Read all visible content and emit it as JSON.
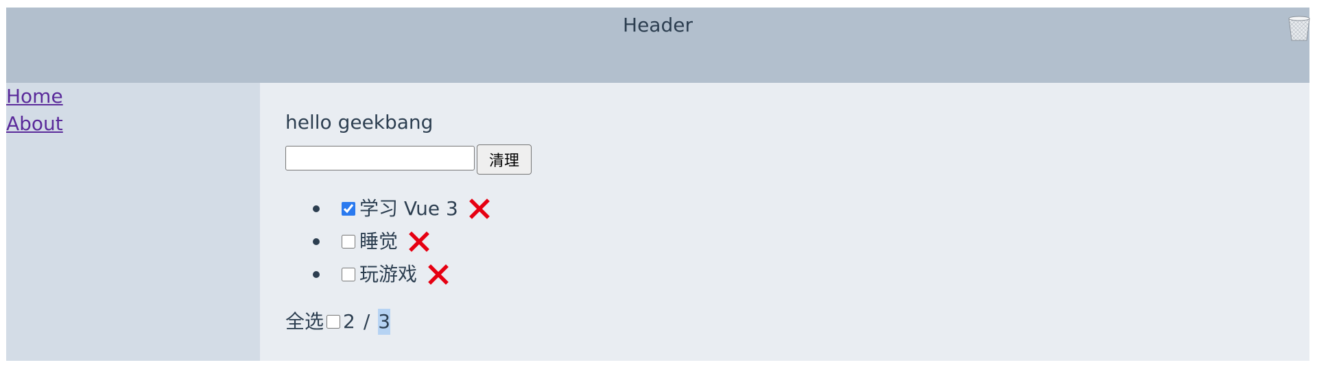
{
  "header": {
    "title": "Header"
  },
  "sidebar": {
    "links": [
      {
        "label": "Home"
      },
      {
        "label": "About"
      }
    ]
  },
  "main": {
    "greeting": "hello geekbang",
    "input": {
      "value": "",
      "placeholder": ""
    },
    "clear_label": "清理",
    "todos": [
      {
        "text": "学习 Vue 3",
        "done": true
      },
      {
        "text": "睡觉",
        "done": false
      },
      {
        "text": "玩游戏",
        "done": false
      }
    ],
    "footer": {
      "select_all_label": "全选",
      "select_all_checked": false,
      "active_count": "2",
      "separator": "/",
      "total_count": "3"
    }
  },
  "colors": {
    "header_bg": "#b2bfcd",
    "sidebar_bg": "#d3dce6",
    "main_bg": "#e9edf2",
    "delete_red": "#e60012",
    "link_color": "#5a2a9a"
  },
  "icons": {
    "trash": "trash-bin-icon",
    "delete": "delete-x-icon"
  }
}
